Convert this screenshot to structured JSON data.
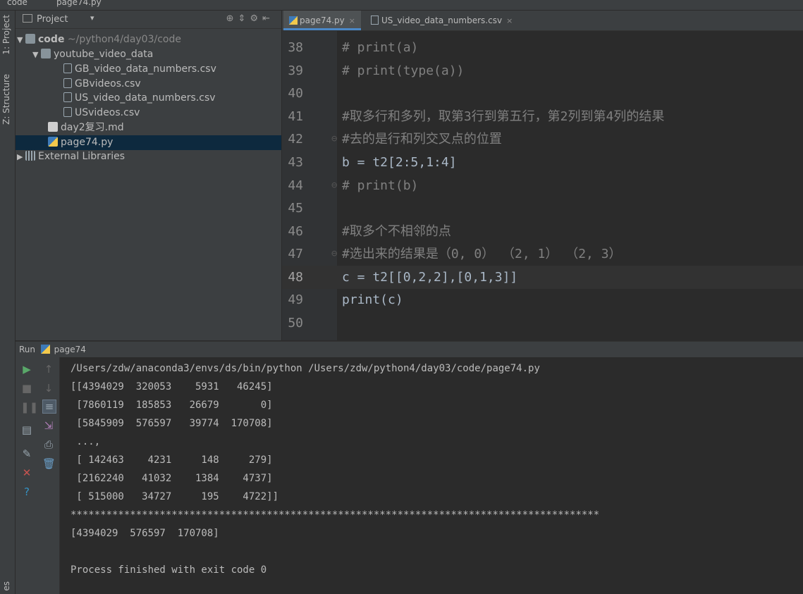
{
  "titlebar": {
    "project": "code",
    "file": "page74.py"
  },
  "sidebar": {
    "tabs": [
      "1: Project",
      "Z: Structure"
    ],
    "bottom_tab": "es"
  },
  "project_panel": {
    "title": "Project",
    "tree": [
      {
        "label": "code",
        "path": "~/python4/day03/code",
        "type": "folder",
        "level": 0,
        "expanded": true
      },
      {
        "label": "youtube_video_data",
        "type": "folder",
        "level": 1,
        "expanded": true
      },
      {
        "label": "GB_video_data_numbers.csv",
        "type": "file",
        "level": 2
      },
      {
        "label": "GBvideos.csv",
        "type": "file",
        "level": 2
      },
      {
        "label": "US_video_data_numbers.csv",
        "type": "file",
        "level": 2
      },
      {
        "label": "USvideos.csv",
        "type": "file",
        "level": 2
      },
      {
        "label": "day2复习.md",
        "type": "md",
        "level": 1
      },
      {
        "label": "page74.py",
        "type": "py",
        "level": 1,
        "selected": true
      },
      {
        "label": "External Libraries",
        "type": "lib",
        "level": 0,
        "expanded": false
      }
    ]
  },
  "editor": {
    "tabs": [
      {
        "label": "page74.py",
        "active": true
      },
      {
        "label": "US_video_data_numbers.csv",
        "active": false
      }
    ],
    "lines": [
      {
        "n": "38",
        "text": "# print(a)"
      },
      {
        "n": "39",
        "text": "# print(type(a))"
      },
      {
        "n": "40",
        "text": ""
      },
      {
        "n": "41",
        "text": "#取多行和多列，取第3行到第五行，第2列到第4列的结果"
      },
      {
        "n": "42",
        "text": "#去的是行和列交叉点的位置"
      },
      {
        "n": "43",
        "text": "b = t2[2:5,1:4]"
      },
      {
        "n": "44",
        "text": "# print(b)"
      },
      {
        "n": "45",
        "text": ""
      },
      {
        "n": "46",
        "text": "#取多个不相邻的点"
      },
      {
        "n": "47",
        "text": "#选出来的结果是（0, 0） （2, 1） （2, 3）"
      },
      {
        "n": "48",
        "text": "c = t2[[0,2,2],[0,1,3]]"
      },
      {
        "n": "49",
        "text": "print(c)"
      },
      {
        "n": "50",
        "text": ""
      }
    ]
  },
  "run_panel": {
    "title": "Run",
    "config": "page74",
    "output": [
      "/Users/zdw/anaconda3/envs/ds/bin/python /Users/zdw/python4/day03/code/page74.py",
      "[[4394029  320053    5931   46245]",
      " [7860119  185853   26679       0]",
      " [5845909  576597   39774  170708]",
      " ...,",
      " [ 142463    4231     148     279]",
      " [2162240   41032    1384    4737]",
      " [ 515000   34727     195    4722]]",
      "*****************************************************************************************",
      "[4394029  576597  170708]",
      "",
      "Process finished with exit code 0"
    ]
  },
  "colors": {
    "accent": "#4a88c7",
    "background": "#2b2b2b",
    "panel": "#3c3f41",
    "selection": "#0d293e"
  }
}
